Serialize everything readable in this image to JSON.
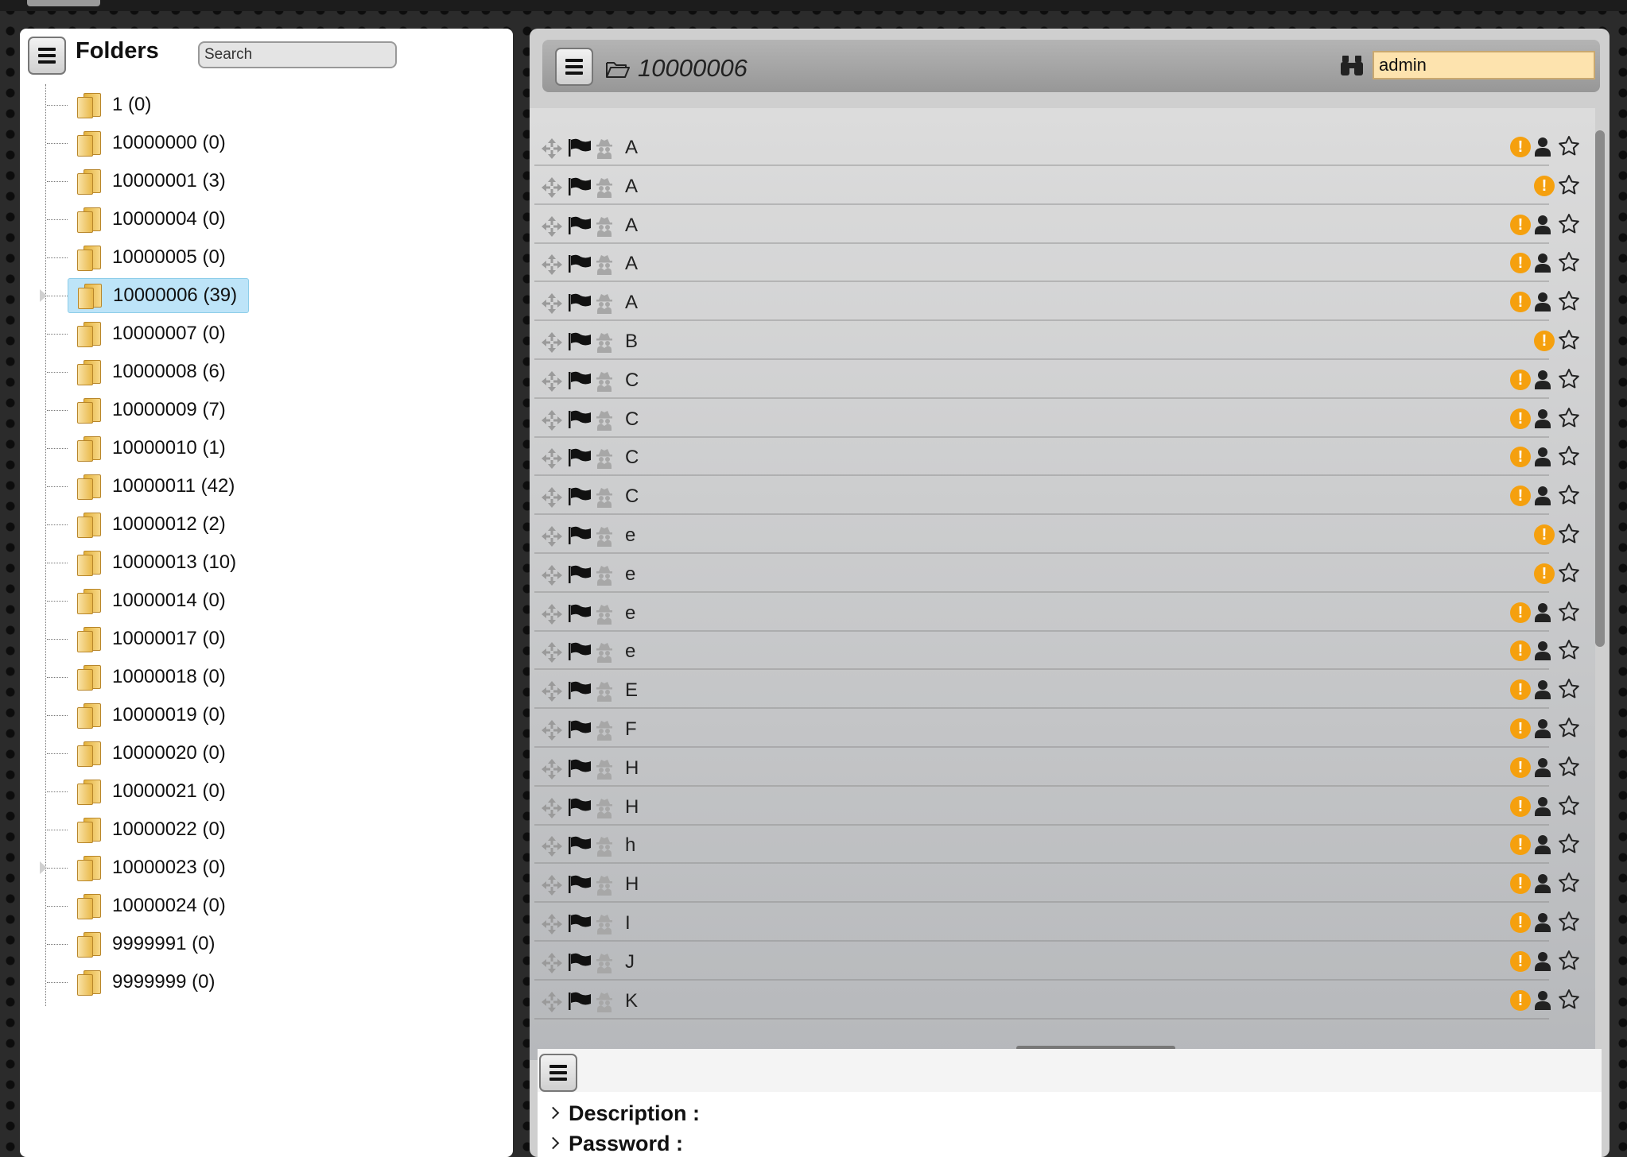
{
  "left_panel": {
    "title": "Folders",
    "search_placeholder": "Search",
    "folders": [
      {
        "label": "1 (0)"
      },
      {
        "label": "10000000 (0)"
      },
      {
        "label": "10000001 (3)"
      },
      {
        "label": "10000004 (0)"
      },
      {
        "label": "10000005 (0)"
      },
      {
        "label": "10000006 (39)",
        "selected": true,
        "expandable": true
      },
      {
        "label": "10000007 (0)"
      },
      {
        "label": "10000008 (6)"
      },
      {
        "label": "10000009 (7)"
      },
      {
        "label": "10000010 (1)"
      },
      {
        "label": "10000011 (42)"
      },
      {
        "label": "10000012 (2)"
      },
      {
        "label": "10000013 (10)"
      },
      {
        "label": "10000014 (0)"
      },
      {
        "label": "10000017 (0)"
      },
      {
        "label": "10000018 (0)"
      },
      {
        "label": "10000019 (0)"
      },
      {
        "label": "10000020 (0)"
      },
      {
        "label": "10000021 (0)"
      },
      {
        "label": "10000022 (0)"
      },
      {
        "label": "10000023 (0)",
        "expandable": true
      },
      {
        "label": "10000024 (0)"
      },
      {
        "label": "9999991 (0)"
      },
      {
        "label": "9999999 (0)"
      }
    ]
  },
  "right_panel": {
    "folder_title": "10000006",
    "user_filter_value": "admin",
    "items": [
      {
        "label": "A",
        "warn": true,
        "user": true
      },
      {
        "label": "A",
        "warn": true,
        "user": false
      },
      {
        "label": "A",
        "warn": true,
        "user": true
      },
      {
        "label": "A",
        "warn": true,
        "user": true
      },
      {
        "label": "A",
        "warn": true,
        "user": true
      },
      {
        "label": "B",
        "warn": true,
        "user": false
      },
      {
        "label": "C",
        "warn": true,
        "user": true
      },
      {
        "label": "C",
        "warn": true,
        "user": true
      },
      {
        "label": "C",
        "warn": true,
        "user": true
      },
      {
        "label": "C",
        "warn": true,
        "user": true
      },
      {
        "label": "e",
        "warn": true,
        "user": false
      },
      {
        "label": "e",
        "warn": true,
        "user": false
      },
      {
        "label": "e",
        "warn": true,
        "user": true
      },
      {
        "label": "e",
        "warn": true,
        "user": true
      },
      {
        "label": "E",
        "warn": true,
        "user": true
      },
      {
        "label": "F",
        "warn": true,
        "user": true
      },
      {
        "label": "H",
        "warn": true,
        "user": true
      },
      {
        "label": "H",
        "warn": true,
        "user": true
      },
      {
        "label": "h",
        "warn": true,
        "user": true
      },
      {
        "label": "H",
        "warn": true,
        "user": true
      },
      {
        "label": "I",
        "warn": true,
        "user": true
      },
      {
        "label": "J",
        "warn": true,
        "user": true
      },
      {
        "label": "K",
        "warn": true,
        "user": true
      }
    ],
    "detail": {
      "description_label": "Description :",
      "password_label": "Password :"
    }
  },
  "colors": {
    "selected_folder_bg": "#bde4f8",
    "warning": "#f5a00e",
    "user_filter_bg": "#fde3ae"
  },
  "icons": {
    "tree_item": "folder-icon",
    "header": [
      "menu-icon",
      "folder-open-icon",
      "binoculars-icon"
    ],
    "row": [
      "move-icon",
      "flag-icon",
      "spy-icon",
      "warning-icon",
      "user-icon",
      "star-icon"
    ]
  }
}
